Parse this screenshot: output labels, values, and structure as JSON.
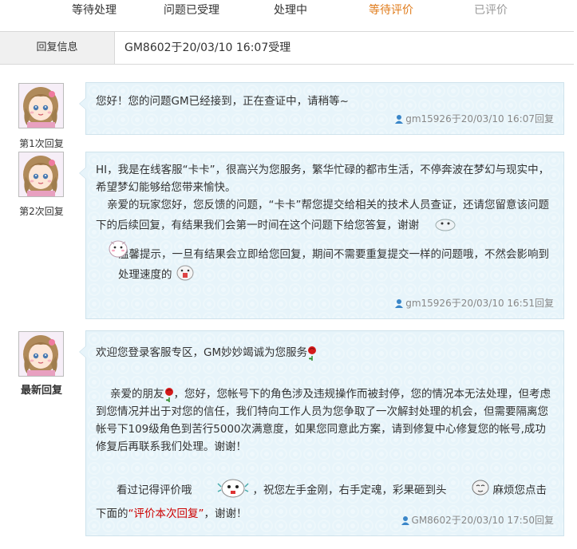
{
  "tabs": [
    {
      "label": "等待处理"
    },
    {
      "label": "问题已受理"
    },
    {
      "label": "处理中"
    },
    {
      "label": "等待评价"
    },
    {
      "label": "已评价"
    }
  ],
  "info": {
    "label": "回复信息",
    "value": "GM8602于20/03/10 16:07受理"
  },
  "replies": [
    {
      "avatar_label": "第1次回复",
      "paragraphs": [
        "您好！您的问题GM已经接到，正在查证中，请稍等~"
      ],
      "meta": "gm15926于20/03/10 16:07回复"
    },
    {
      "avatar_label": "第2次回复",
      "paragraphs": [
        "HI，我是在线客服“卡卡”，很高兴为您服务，繁华忙碌的都市生活，不停奔波在梦幻与现实中，希望梦幻能够给您带来愉快。",
        "亲爱的玩家您好，您反馈的问题，“卡卡”帮您提交给相关的技术人员查证，还请您留意该问题下的后续回复，有结果我们会第一时间在这个问题下给您答复，谢谢",
        "温馨提示，一旦有结果会立即给您回复，期间不需要重复提交一样的问题哦，不然会影响到处理速度的"
      ],
      "meta": "gm15926于20/03/10 16:51回复"
    },
    {
      "avatar_label": "最新回复",
      "p1": "欢迎您登录客服专区，GM妙妙竭诚为您服务",
      "p2a": "亲爱的朋友",
      "p2b": "，您好，您帐号下的角色涉及违规操作而被封停，您的情况本无法处理，但考虑到您情况并出于对您的信任，我们特向工作人员为您争取了一次解封处理的机会，但需要隔离您帐号下109级角色到苦行5000次满意度，如果您同意此方案，请到修复中心修复您的帐号,成功修复后再联系我们处理。谢谢！",
      "p3a": "看过记得评价哦",
      "p3b": "，祝您左手金刚，右手定魂，彩果砸到头",
      "p3c": "麻烦您点击下面的",
      "link": "“评价本次回复”",
      "p3d": "，谢谢！",
      "meta": "GM8602于20/03/10 17:50回复"
    }
  ],
  "colors": {
    "active_tab": "#e07b1a",
    "bubble_bg": "#e7f4fa",
    "link": "#c00000"
  },
  "icons": [
    "person-icon",
    "rose-icon",
    "emoticon-icon"
  ]
}
